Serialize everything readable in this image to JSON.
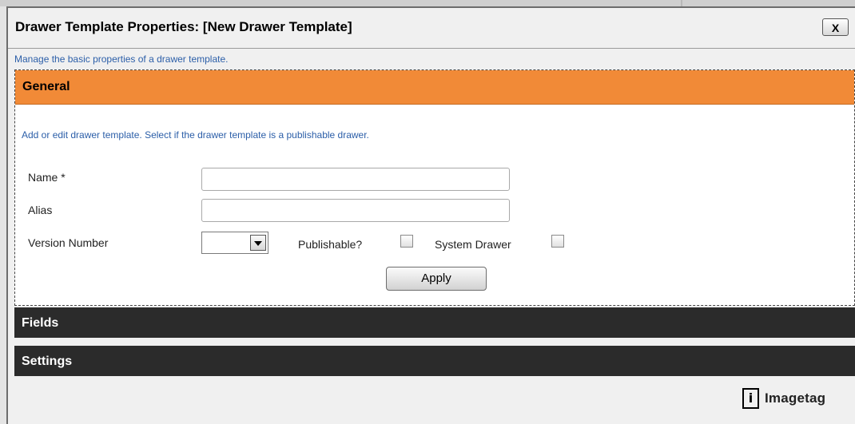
{
  "dialog": {
    "title": "Drawer Template Properties: [New Drawer Template]",
    "close_label": "X",
    "description": "Manage the basic properties of a drawer template."
  },
  "general": {
    "header": "General",
    "description": "Add or edit drawer template. Select if the drawer template is a publishable drawer.",
    "name_label": "Name *",
    "name_value": "",
    "alias_label": "Alias",
    "alias_value": "",
    "version_label": "Version Number",
    "version_value": "",
    "publishable_label": "Publishable?",
    "publishable_checked": false,
    "system_drawer_label": "System Drawer",
    "system_drawer_checked": false,
    "apply_label": "Apply"
  },
  "sections": {
    "fields_label": "Fields",
    "settings_label": "Settings"
  },
  "brand": {
    "logo_glyph": "i",
    "logo_name": "Imagetag"
  },
  "colors": {
    "accent": "#f18a37",
    "section_dark": "#2b2b2b",
    "link_text": "#2b5ea8"
  }
}
